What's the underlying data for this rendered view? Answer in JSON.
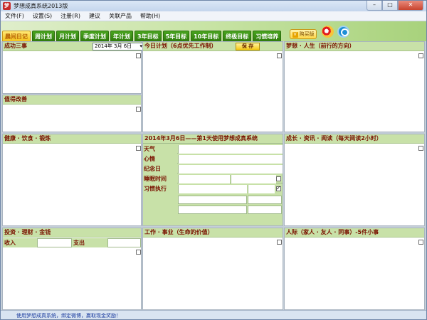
{
  "window": {
    "title": "梦想成真系统2013版",
    "app_icon": "app-logo-icon"
  },
  "menu": [
    "文件(F)",
    "设置(S)",
    "注册(R)",
    "建议",
    "关联产品",
    "帮助(H)"
  ],
  "tabs": [
    {
      "label": "晨间日记",
      "active": true
    },
    {
      "label": "周计划",
      "active": false
    },
    {
      "label": "月计划",
      "active": false
    },
    {
      "label": "季度计划",
      "active": false
    },
    {
      "label": "年计划",
      "active": false
    },
    {
      "label": "3年目标",
      "active": false
    },
    {
      "label": "5年目标",
      "active": false
    },
    {
      "label": "10年目标",
      "active": false
    },
    {
      "label": "终极目标",
      "active": false
    },
    {
      "label": "习惯培养",
      "active": false
    }
  ],
  "toolbar": {
    "vip_label": "购买版"
  },
  "panels": {
    "success": {
      "title": "成功三事",
      "date_value": "2014年 3月 6日"
    },
    "plan": {
      "title": "今日计划（6点优先工作制）",
      "save_label": "保 存"
    },
    "dream": {
      "title": "梦想 · 人生（前行的方向）"
    },
    "improve": {
      "title": "值得改善"
    },
    "health": {
      "title": "健康 · 饮食 · 锻炼"
    },
    "daily": {
      "title": "2014年3月6日——第1天使用梦想成真系统",
      "rows": [
        "天气",
        "心情",
        "纪念日",
        "睡眠时间",
        "习惯执行"
      ]
    },
    "growth": {
      "title": "成长 · 资讯 · 阅读（每天阅读2小时）"
    },
    "finance": {
      "title": "投资 · 理财 · 金钱",
      "income_label": "收入",
      "expense_label": "支出"
    },
    "work": {
      "title": "工作 · 事业（生命的价值）"
    },
    "people": {
      "title": "人际（家人 · 友人 · 同事）-5件小事"
    }
  },
  "status": {
    "text": "使用梦想成真系统，绑定微博，赢取现金奖励！"
  },
  "colors": {
    "tab_green": "#3a8c15",
    "tab_active": "#f3c21a",
    "header_green": "#c8e1a8",
    "header_text": "#7a1200"
  }
}
